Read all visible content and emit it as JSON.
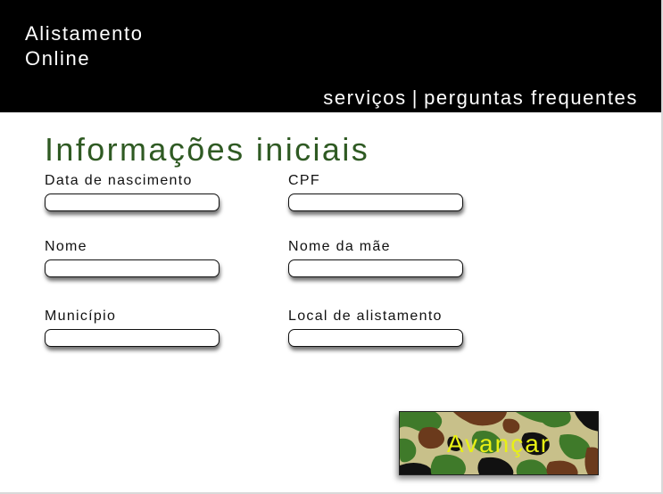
{
  "header": {
    "brand_line1": "Alistamento",
    "brand_line2": "Online",
    "nav": {
      "services": "serviços",
      "separator": "|",
      "faq": "perguntas frequentes"
    },
    "background": "#000000"
  },
  "form": {
    "title": "Informações iniciais",
    "title_color": "#2f5a23",
    "fields": {
      "birth_date": {
        "label": "Data de nascimento",
        "value": "",
        "placeholder": ""
      },
      "cpf": {
        "label": "CPF",
        "value": "",
        "placeholder": ""
      },
      "name": {
        "label": "Nome",
        "value": "",
        "placeholder": ""
      },
      "mother_name": {
        "label": "Nome da mãe",
        "value": "",
        "placeholder": ""
      },
      "municipality": {
        "label": "Município",
        "value": "",
        "placeholder": ""
      },
      "enlistment_location": {
        "label": "Local de alistamento",
        "value": "",
        "placeholder": ""
      }
    }
  },
  "actions": {
    "next_label": "Avançar",
    "next_text_color": "#e8f014",
    "next_pattern": "camouflage",
    "camo_colors": [
      "#c8c08a",
      "#3f7a2a",
      "#6b3a1c",
      "#111111"
    ]
  }
}
